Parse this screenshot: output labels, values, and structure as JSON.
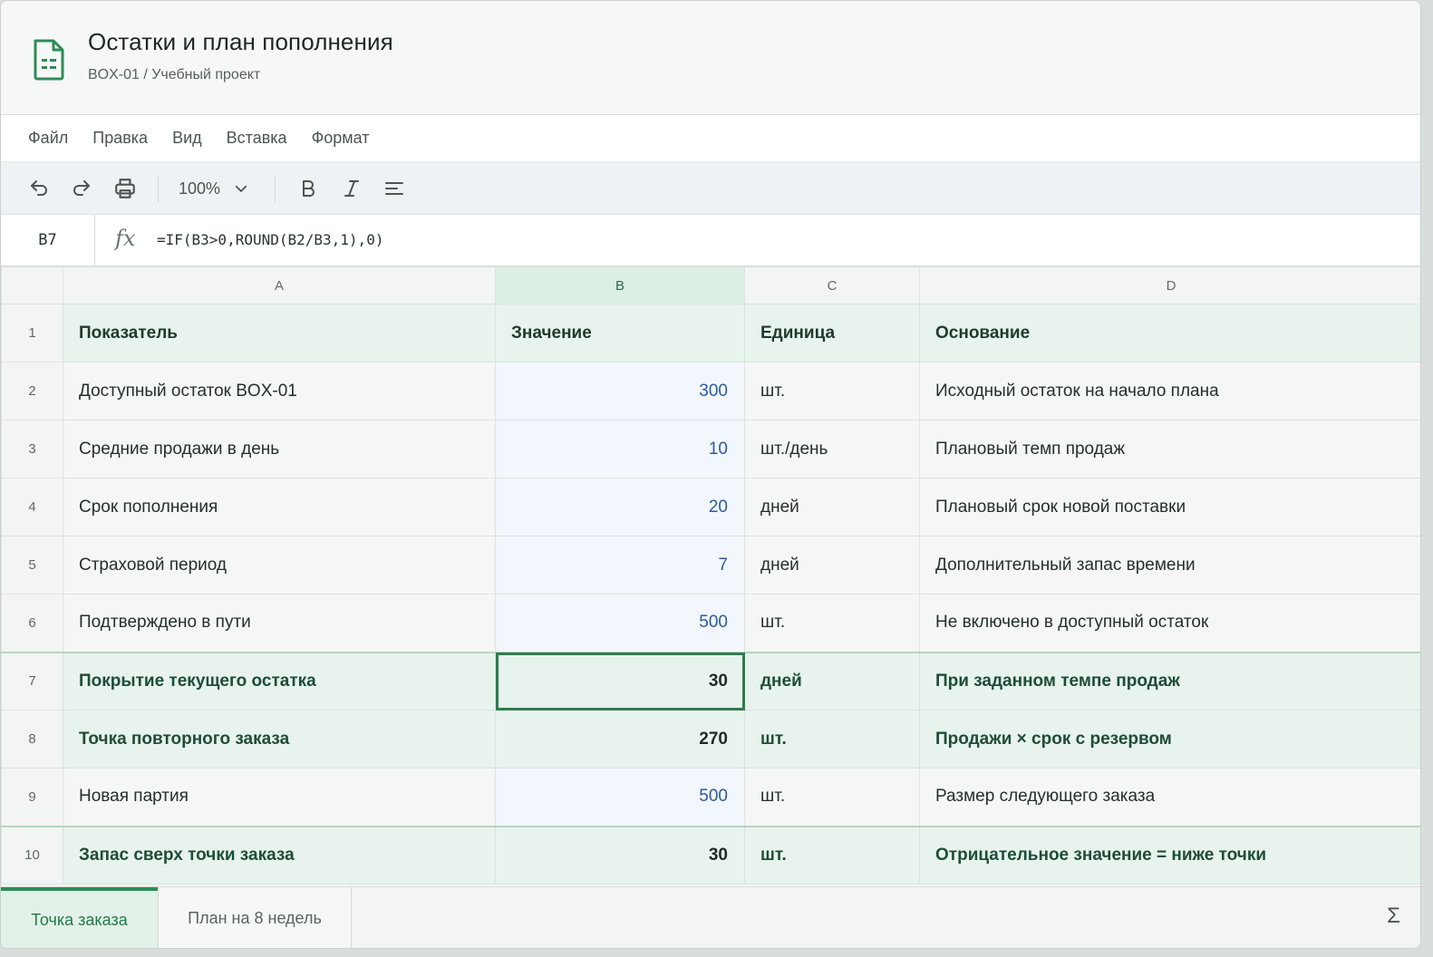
{
  "doc": {
    "title": "Остатки и план пополнения",
    "subtitle": "BOX-01 / Учебный проект"
  },
  "menu": [
    "Файл",
    "Правка",
    "Вид",
    "Вставка",
    "Формат"
  ],
  "toolbar": {
    "zoom": "100%",
    "icons": [
      "undo-icon",
      "redo-icon",
      "print-icon",
      "bold-icon",
      "italic-icon",
      "align-icon"
    ]
  },
  "formula_bar": {
    "cell": "B7",
    "fx": "fx",
    "formula": "=IF(B3>0,ROUND(B2/B3,1),0)"
  },
  "columns": [
    "A",
    "B",
    "C",
    "D"
  ],
  "rows": [
    {
      "n": "1",
      "a": "Показатель",
      "b": "Значение",
      "c": "Единица",
      "d": "Основание"
    },
    {
      "n": "2",
      "a": "Доступный остаток BOX-01",
      "b": "300",
      "c": "шт.",
      "d": "Исходный остаток на начало плана"
    },
    {
      "n": "3",
      "a": "Средние продажи в день",
      "b": "10",
      "c": "шт./день",
      "d": "Плановый темп продаж"
    },
    {
      "n": "4",
      "a": "Срок пополнения",
      "b": "20",
      "c": "дней",
      "d": "Плановый срок новой поставки"
    },
    {
      "n": "5",
      "a": "Страховой период",
      "b": "7",
      "c": "дней",
      "d": "Дополнительный запас времени"
    },
    {
      "n": "6",
      "a": "Подтверждено в пути",
      "b": "500",
      "c": "шт.",
      "d": "Не включено в доступный остаток"
    },
    {
      "n": "7",
      "a": "Покрытие текущего остатка",
      "b": "30",
      "c": "дней",
      "d": "При заданном темпе продаж"
    },
    {
      "n": "8",
      "a": "Точка повторного заказа",
      "b": "270",
      "c": "шт.",
      "d": "Продажи × срок с резервом"
    },
    {
      "n": "9",
      "a": "Новая партия",
      "b": "500",
      "c": "шт.",
      "d": "Размер следующего заказа"
    },
    {
      "n": "10",
      "a": "Запас сверх точки заказа",
      "b": "30",
      "c": "шт.",
      "d": "Отрицательное значение = ниже точки"
    }
  ],
  "tabs": {
    "active": "Точка заказа",
    "other": "План на 8 недель"
  },
  "sigma": "Σ",
  "colors": {
    "accent": "#2e8b57",
    "input_text": "#2d5aa0",
    "calc_bg": "#e7f3ec"
  }
}
